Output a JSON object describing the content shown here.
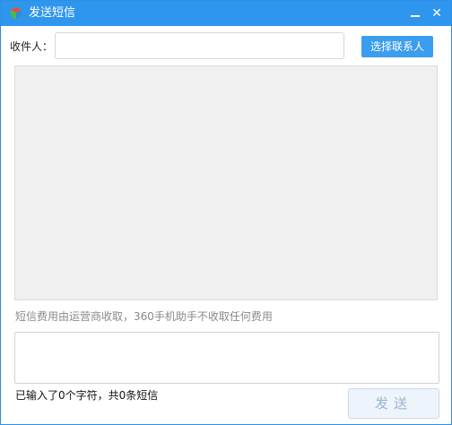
{
  "window": {
    "title": "发送短信",
    "minimize_icon": "minimize-icon",
    "close_label": "✕"
  },
  "recipient": {
    "label": "收件人：",
    "value": "",
    "placeholder": "",
    "select_contact_label": "选择联系人"
  },
  "notice": {
    "fee_text": "短信费用由运营商收取，360手机助手不收取任何费用"
  },
  "compose": {
    "value": "",
    "counter_text": "已输入了0个字符，共0条短信",
    "send_label": "发送"
  },
  "colors": {
    "titlebar": "#2f96ee",
    "contact_button": "#3a9ded",
    "history_background": "#f0f0f0",
    "send_disabled_text": "#9bb3cc"
  }
}
